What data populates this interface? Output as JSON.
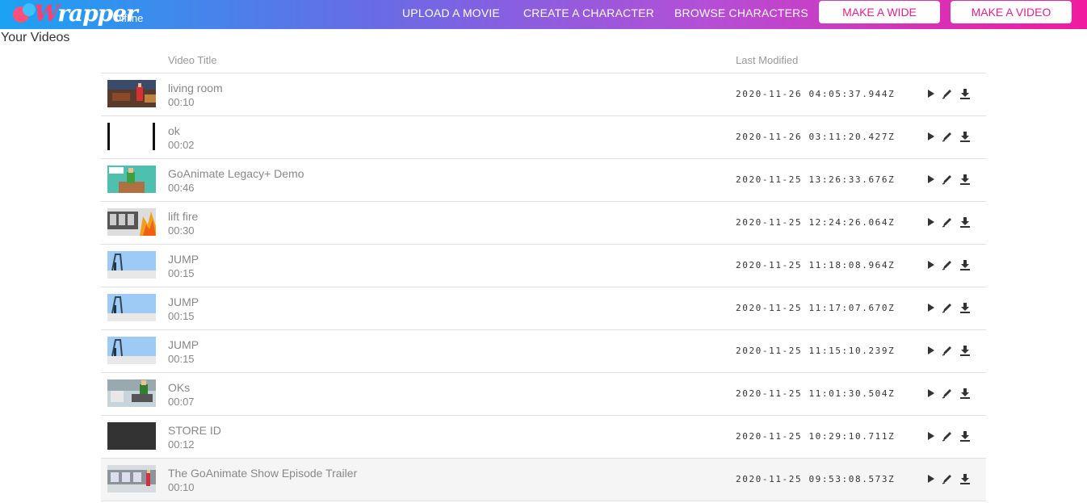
{
  "header": {
    "logo_main": "rapper",
    "logo_initial": "W",
    "logo_sub": "Offline",
    "nav": [
      "UPLOAD A MOVIE",
      "CREATE A CHARACTER",
      "BROWSE CHARACTERS"
    ],
    "buttons": [
      "MAKE A WIDE",
      "MAKE A VIDEO"
    ]
  },
  "page": {
    "title": "Your Videos"
  },
  "table": {
    "columns": [
      "Video Title",
      "Last Modified"
    ],
    "rows": [
      {
        "title": "living room",
        "duration": "00:10",
        "modified": "2020-11-26 04:05:37.944Z",
        "thumb": "living-room"
      },
      {
        "title": "ok",
        "duration": "00:02",
        "modified": "2020-11-26 03:11:20.427Z",
        "thumb": "bars"
      },
      {
        "title": "GoAnimate Legacy+ Demo",
        "duration": "00:46",
        "modified": "2020-11-25 13:26:33.676Z",
        "thumb": "teal"
      },
      {
        "title": "lift fire",
        "duration": "00:30",
        "modified": "2020-11-25 12:24:26.064Z",
        "thumb": "fire"
      },
      {
        "title": "JUMP",
        "duration": "00:15",
        "modified": "2020-11-25 11:18:08.964Z",
        "thumb": "jump"
      },
      {
        "title": "JUMP",
        "duration": "00:15",
        "modified": "2020-11-25 11:17:07.670Z",
        "thumb": "jump"
      },
      {
        "title": "JUMP",
        "duration": "00:15",
        "modified": "2020-11-25 11:15:10.239Z",
        "thumb": "jump"
      },
      {
        "title": "OKs",
        "duration": "00:07",
        "modified": "2020-11-25 11:01:30.504Z",
        "thumb": "oks"
      },
      {
        "title": "STORE ID",
        "duration": "00:12",
        "modified": "2020-11-25 10:29:10.711Z",
        "thumb": "dark"
      },
      {
        "title": "The GoAnimate Show Episode Trailer",
        "duration": "00:10",
        "modified": "2020-11-25 09:53:08.573Z",
        "thumb": "trailer"
      }
    ],
    "row_actions": [
      "play-icon",
      "edit-pencil-icon",
      "download-icon"
    ]
  }
}
